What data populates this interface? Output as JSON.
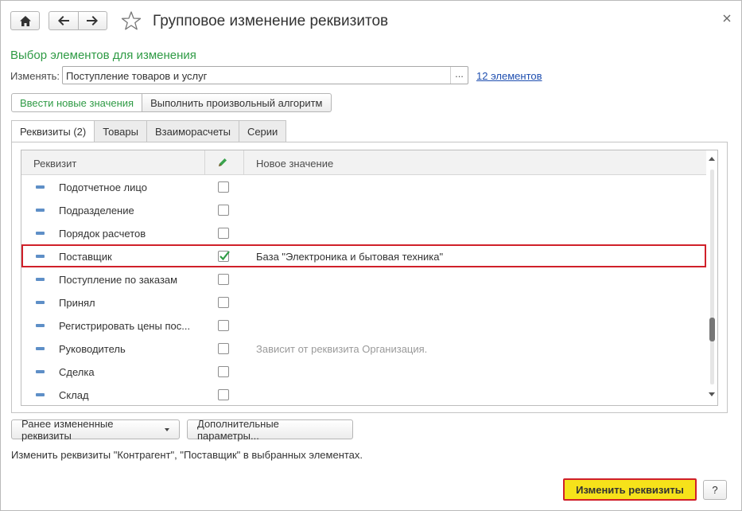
{
  "window": {
    "title": "Групповое изменение реквизитов",
    "icons": {
      "home": "home-icon",
      "back": "arrow-left-icon",
      "forward": "arrow-right-icon",
      "favorite": "star-icon",
      "close": "close-icon"
    }
  },
  "selection": {
    "section_title": "Выбор элементов для изменения",
    "change_label": "Изменять:",
    "change_value": "Поступление товаров и услуг",
    "choose_button": "...",
    "elements_link": "12 элементов"
  },
  "mode_buttons": {
    "enter_new_values": "Ввести новые значения",
    "run_algorithm": "Выполнить произвольный алгоритм"
  },
  "tabs": [
    "Реквизиты (2)",
    "Товары",
    "Взаиморасчеты",
    "Серии"
  ],
  "grid": {
    "col_attribute": "Реквизит",
    "col_new_value": "Новое значение",
    "edit_icon": "pencil-icon",
    "rows": [
      {
        "name": "Подотчетное лицо",
        "checked": false,
        "new_value": ""
      },
      {
        "name": "Подразделение",
        "checked": false,
        "new_value": ""
      },
      {
        "name": "Порядок расчетов",
        "checked": false,
        "new_value": ""
      },
      {
        "name": "Поставщик",
        "checked": true,
        "new_value": "База \"Электроника и бытовая техника\"",
        "highlighted": true
      },
      {
        "name": "Поступление по заказам",
        "checked": false,
        "new_value": ""
      },
      {
        "name": "Принял",
        "checked": false,
        "new_value": ""
      },
      {
        "name": "Регистрировать цены пос...",
        "checked": false,
        "new_value": ""
      },
      {
        "name": "Руководитель",
        "checked": false,
        "new_value": "Зависит от реквизита Организация.",
        "hint": true
      },
      {
        "name": "Сделка",
        "checked": false,
        "new_value": ""
      },
      {
        "name": "Склад",
        "checked": false,
        "new_value": ""
      }
    ]
  },
  "bottom": {
    "previously_changed": "Ранее измененные реквизиты",
    "additional_params": "Дополнительные параметры...",
    "note": "Изменить реквизиты \"Контрагент\", \"Поставщик\" в выбранных элементах.",
    "apply": "Изменить реквизиты",
    "help": "?"
  },
  "colors": {
    "accent_green": "#2f9b45",
    "apply_yellow": "#f6e21a",
    "highlight_red": "#d0202a",
    "link_blue": "#1f4fb0"
  }
}
